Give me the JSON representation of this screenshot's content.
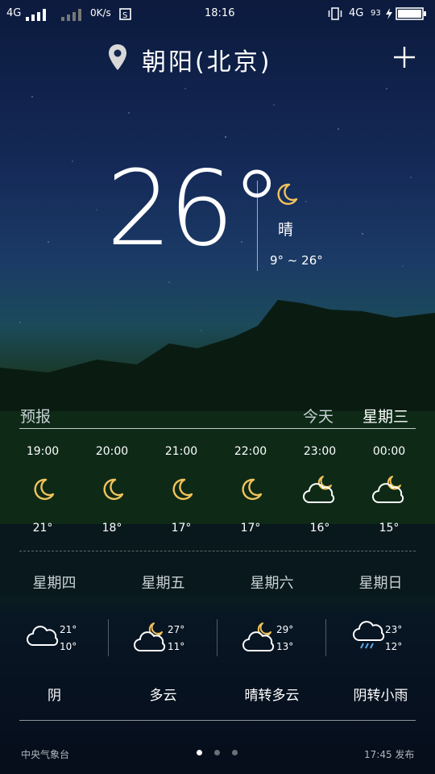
{
  "status_bar": {
    "network": "4G",
    "speed": "0K/s",
    "time": "18:16",
    "network2": "4G",
    "battery": "93"
  },
  "header": {
    "city": "朝阳(北京)"
  },
  "current": {
    "temp": "26°",
    "condition": "晴",
    "range": "9° ~ 26°",
    "icon": "moon-icon"
  },
  "forecast_header": {
    "title": "预报",
    "today": "今天",
    "weekday": "星期三"
  },
  "hourly": [
    {
      "time": "19:00",
      "icon": "moon-icon",
      "temp": "21°"
    },
    {
      "time": "20:00",
      "icon": "moon-icon",
      "temp": "18°"
    },
    {
      "time": "21:00",
      "icon": "moon-icon",
      "temp": "17°"
    },
    {
      "time": "22:00",
      "icon": "moon-icon",
      "temp": "17°"
    },
    {
      "time": "23:00",
      "icon": "cloudy-night-icon",
      "temp": "16°"
    },
    {
      "time": "00:00",
      "icon": "cloudy-night-icon",
      "temp": "15°"
    }
  ],
  "daily": [
    {
      "day": "星期四",
      "icon": "cloud-icon",
      "high": "21°",
      "low": "10°",
      "condition": "阴"
    },
    {
      "day": "星期五",
      "icon": "cloudy-night-icon",
      "high": "27°",
      "low": "11°",
      "condition": "多云"
    },
    {
      "day": "星期六",
      "icon": "cloudy-night-icon",
      "high": "29°",
      "low": "13°",
      "condition": "晴转多云"
    },
    {
      "day": "星期日",
      "icon": "rain-cloud-icon",
      "high": "23°",
      "low": "12°",
      "condition": "阴转小雨"
    }
  ],
  "footer": {
    "source": "中央气象台",
    "published": "17:45 发布",
    "page_total": 3,
    "page_current": 1
  },
  "colors": {
    "moon": "#f2c25a",
    "text": "#ffffff",
    "muted": "#c9d2d6"
  }
}
